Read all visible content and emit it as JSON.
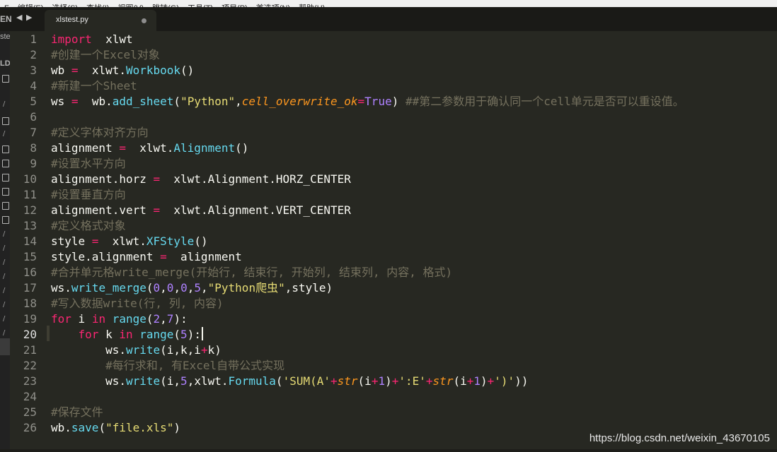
{
  "menubar": {
    "items": [
      "F",
      "编辑(E)",
      "选择(S)",
      "查找(I)",
      "视图(V)",
      "跳转(G)",
      "工具(T)",
      "项目(P)",
      "首选项(N)",
      "帮助(H)"
    ]
  },
  "sidebar": {
    "header_label": "EN",
    "folder_label": "LD",
    "partial_item": "ste"
  },
  "tab": {
    "filename": "xlstest.py",
    "modified": true
  },
  "editor": {
    "current_line": 20,
    "line_numbers": [
      "1",
      "2",
      "3",
      "4",
      "5",
      "6",
      "7",
      "8",
      "9",
      "10",
      "11",
      "12",
      "13",
      "14",
      "15",
      "16",
      "17",
      "18",
      "19",
      "20",
      "21",
      "22",
      "23",
      "24",
      "25",
      "26"
    ],
    "lines": [
      [
        [
          "k",
          "import"
        ],
        [
          "",
          "  xlwt"
        ]
      ],
      [
        [
          "c",
          "#创建一个Excel对象"
        ]
      ],
      [
        [
          "",
          "wb "
        ],
        [
          "k",
          "="
        ],
        [
          "",
          "  xlwt."
        ],
        [
          "f",
          "Workbook"
        ],
        [
          "",
          "()"
        ]
      ],
      [
        [
          "c",
          "#新建一个Sheet"
        ]
      ],
      [
        [
          "",
          "ws "
        ],
        [
          "k",
          "="
        ],
        [
          "",
          "  wb."
        ],
        [
          "f",
          "add_sheet"
        ],
        [
          "",
          "("
        ],
        [
          "s",
          "\"Python\""
        ],
        [
          "",
          ","
        ],
        [
          "p",
          "cell_overwrite_ok"
        ],
        [
          "k",
          "="
        ],
        [
          "n",
          "True"
        ],
        [
          "",
          ") "
        ],
        [
          "c",
          "##第二参数用于确认同一个cell单元是否可以重设值。"
        ]
      ],
      [],
      [
        [
          "c",
          "#定义字体对齐方向"
        ]
      ],
      [
        [
          "",
          "alignment "
        ],
        [
          "k",
          "="
        ],
        [
          "",
          "  xlwt."
        ],
        [
          "f",
          "Alignment"
        ],
        [
          "",
          "()"
        ]
      ],
      [
        [
          "c",
          "#设置水平方向"
        ]
      ],
      [
        [
          "",
          "alignment.horz "
        ],
        [
          "k",
          "="
        ],
        [
          "",
          "  xlwt.Alignment.HORZ_CENTER"
        ]
      ],
      [
        [
          "c",
          "#设置垂直方向"
        ]
      ],
      [
        [
          "",
          "alignment.vert "
        ],
        [
          "k",
          "="
        ],
        [
          "",
          "  xlwt.Alignment.VERT_CENTER"
        ]
      ],
      [
        [
          "c",
          "#定义格式对象"
        ]
      ],
      [
        [
          "",
          "style "
        ],
        [
          "k",
          "="
        ],
        [
          "",
          "  xlwt."
        ],
        [
          "f",
          "XFStyle"
        ],
        [
          "",
          "()"
        ]
      ],
      [
        [
          "",
          "style.alignment "
        ],
        [
          "k",
          "="
        ],
        [
          "",
          "  alignment"
        ]
      ],
      [
        [
          "c",
          "#合并单元格write_merge(开始行, 结束行, 开始列, 结束列, 内容, 格式)"
        ]
      ],
      [
        [
          "",
          "ws."
        ],
        [
          "f",
          "write_merge"
        ],
        [
          "",
          "("
        ],
        [
          "n",
          "0"
        ],
        [
          "",
          ","
        ],
        [
          "n",
          "0"
        ],
        [
          "",
          ","
        ],
        [
          "n",
          "0"
        ],
        [
          "",
          ","
        ],
        [
          "n",
          "5"
        ],
        [
          "",
          ","
        ],
        [
          "s",
          "\"Python爬虫\""
        ],
        [
          "",
          ",style)"
        ]
      ],
      [
        [
          "c",
          "#写入数据write(行, 列, 内容)"
        ]
      ],
      [
        [
          "k",
          "for"
        ],
        [
          "",
          ""
        ],
        [
          "",
          " i "
        ],
        [
          "k",
          "in"
        ],
        [
          "",
          ""
        ],
        [
          "f",
          " range"
        ],
        [
          "",
          "("
        ],
        [
          "n",
          "2"
        ],
        [
          "",
          ","
        ],
        [
          "n",
          "7"
        ],
        [
          "",
          "):"
        ]
      ],
      [
        [
          "",
          "    "
        ],
        [
          "k",
          "for"
        ],
        [
          "",
          " k "
        ],
        [
          "k",
          "in"
        ],
        [
          "f",
          " range"
        ],
        [
          "",
          "("
        ],
        [
          "n",
          "5"
        ],
        [
          "",
          "):"
        ]
      ],
      [
        [
          "",
          "        ws."
        ],
        [
          "f",
          "write"
        ],
        [
          "",
          "(i,k,i"
        ],
        [
          "k",
          "+"
        ],
        [
          "",
          "k)"
        ]
      ],
      [
        [
          "c",
          "        #每行求和, 有Excel自带公式实现"
        ]
      ],
      [
        [
          "",
          "        ws."
        ],
        [
          "f",
          "write"
        ],
        [
          "",
          "(i,"
        ],
        [
          "n",
          "5"
        ],
        [
          "",
          ",xlwt."
        ],
        [
          "f",
          "Formula"
        ],
        [
          "",
          "("
        ],
        [
          "s",
          "'SUM(A'"
        ],
        [
          "k",
          "+"
        ],
        [
          "p",
          "str"
        ],
        [
          "",
          "(i"
        ],
        [
          "k",
          "+"
        ],
        [
          "n",
          "1"
        ],
        [
          "",
          ")"
        ],
        [
          "k",
          "+"
        ],
        [
          "s",
          "':E'"
        ],
        [
          "k",
          "+"
        ],
        [
          "p",
          "str"
        ],
        [
          "",
          "(i"
        ],
        [
          "k",
          "+"
        ],
        [
          "n",
          "1"
        ],
        [
          "",
          ")"
        ],
        [
          "k",
          "+"
        ],
        [
          "s",
          "')'"
        ],
        [
          "",
          "))"
        ]
      ],
      [],
      [
        [
          "c",
          "#保存文件"
        ]
      ],
      [
        [
          "",
          "wb."
        ],
        [
          "f",
          "save"
        ],
        [
          "",
          "("
        ],
        [
          "s",
          "\"file.xls\""
        ],
        [
          "",
          ")"
        ]
      ]
    ]
  },
  "watermark": "https://blog.csdn.net/weixin_43670105"
}
